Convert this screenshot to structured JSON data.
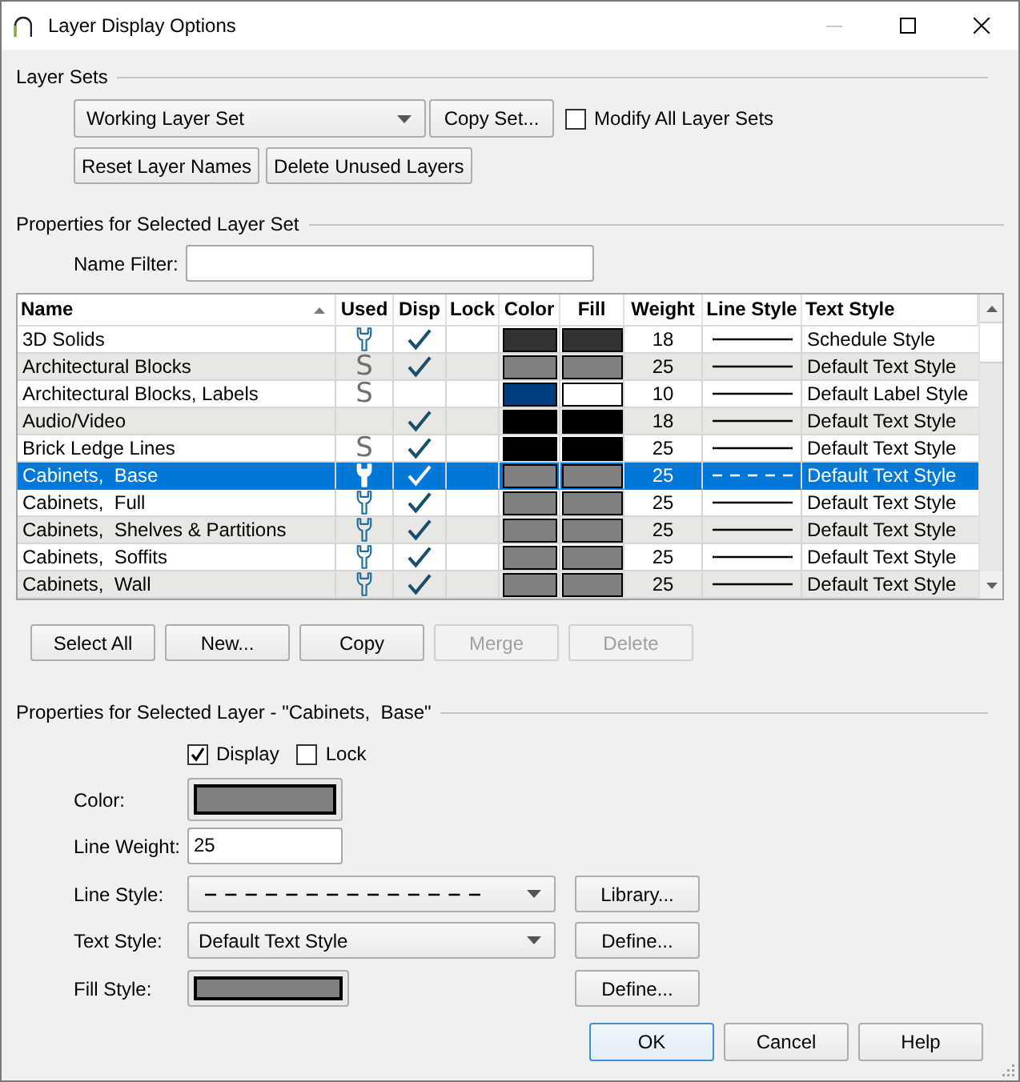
{
  "window": {
    "title": "Layer Display Options",
    "controls": [
      {
        "kind": "minimize",
        "disabled": true
      },
      {
        "kind": "maximize",
        "disabled": false
      },
      {
        "kind": "close",
        "disabled": false
      }
    ]
  },
  "layer_sets": {
    "heading": "Layer Sets",
    "set_dropdown": "Working Layer Set",
    "copy_button": "Copy Set...",
    "modify_all": {
      "label": "Modify All Layer Sets",
      "checked": false
    },
    "buttons": [
      {
        "label": "Reset Layer Names",
        "disabled": false
      },
      {
        "label": "Delete Unused Layers",
        "disabled": false
      }
    ]
  },
  "layer_set_properties": {
    "heading": "Properties for Selected Layer Set",
    "name_filter_label": "Name Filter:"
  },
  "table": {
    "columns": [
      {
        "label": "Name",
        "sorted": true
      },
      {
        "label": "Used",
        "sorted": false
      },
      {
        "label": "Disp",
        "sorted": false
      },
      {
        "label": "Lock",
        "sorted": false
      },
      {
        "label": "Color",
        "sorted": false
      },
      {
        "label": "Fill",
        "sorted": false
      },
      {
        "label": "Weight",
        "sorted": false
      },
      {
        "label": "Line Style",
        "sorted": false
      },
      {
        "label": "Text Style",
        "sorted": false
      }
    ],
    "rows": [
      {
        "name": "3D Solids",
        "used": {
          "kind": "wrench"
        },
        "display": true,
        "lock": false,
        "color": "#333333",
        "fill": {
          "color": "#333333"
        },
        "weight": "18",
        "line": {
          "kind": "solid"
        },
        "text_style": "Schedule Style",
        "selected": false
      },
      {
        "name": "Architectural Blocks",
        "used": {
          "kind": "letter",
          "text": "S"
        },
        "display": true,
        "lock": false,
        "color": "#808080",
        "fill": {
          "color": "#808080"
        },
        "weight": "25",
        "line": {
          "kind": "solid"
        },
        "text_style": "Default Text Style",
        "selected": false
      },
      {
        "name": "Architectural Blocks, Labels",
        "used": {
          "kind": "letter",
          "text": "S"
        },
        "display": false,
        "lock": false,
        "color": "#003f7f",
        "fill": {
          "color": "#ffffff"
        },
        "weight": "10",
        "line": {
          "kind": "solid"
        },
        "text_style": "Default Label Style",
        "selected": false
      },
      {
        "name": "Audio/Video",
        "display": true,
        "lock": false,
        "color": "#000000",
        "fill": {
          "color": "#000000"
        },
        "weight": "18",
        "line": {
          "kind": "solid"
        },
        "text_style": "Default Text Style",
        "selected": false
      },
      {
        "name": "Brick Ledge Lines",
        "used": {
          "kind": "letter",
          "text": "S"
        },
        "display": true,
        "lock": false,
        "color": "#000000",
        "fill": {
          "color": "#000000"
        },
        "weight": "25",
        "line": {
          "kind": "solid"
        },
        "text_style": "Default Text Style",
        "selected": false
      },
      {
        "name": "Cabinets,  Base",
        "used": {
          "kind": "wrench"
        },
        "display": true,
        "lock": false,
        "color": "#808080",
        "fill": {
          "color": "#808080"
        },
        "weight": "25",
        "line": {
          "kind": "dashed"
        },
        "text_style": "Default Text Style",
        "selected": true
      },
      {
        "name": "Cabinets,  Full",
        "used": {
          "kind": "wrench"
        },
        "display": true,
        "lock": false,
        "color": "#808080",
        "fill": {
          "color": "#808080"
        },
        "weight": "25",
        "line": {
          "kind": "solid"
        },
        "text_style": "Default Text Style",
        "selected": false
      },
      {
        "name": "Cabinets,  Shelves & Partitions",
        "used": {
          "kind": "wrench"
        },
        "display": true,
        "lock": false,
        "color": "#808080",
        "fill": {
          "color": "#808080"
        },
        "weight": "25",
        "line": {
          "kind": "solid"
        },
        "text_style": "Default Text Style",
        "selected": false
      },
      {
        "name": "Cabinets,  Soffits",
        "used": {
          "kind": "wrench"
        },
        "display": true,
        "lock": false,
        "color": "#808080",
        "fill": {
          "color": "#808080"
        },
        "weight": "25",
        "line": {
          "kind": "solid"
        },
        "text_style": "Default Text Style",
        "selected": false
      },
      {
        "name": "Cabinets,  Wall",
        "used": {
          "kind": "wrench"
        },
        "display": true,
        "lock": false,
        "color": "#808080",
        "fill": {
          "color": "#808080"
        },
        "weight": "25",
        "line": {
          "kind": "solid"
        },
        "text_style": "Default Text Style",
        "selected": false
      }
    ]
  },
  "table_buttons": [
    {
      "label": "Select All",
      "disabled": false
    },
    {
      "label": "New...",
      "disabled": false
    },
    {
      "label": "Copy",
      "disabled": false
    },
    {
      "label": "Merge",
      "disabled": true
    },
    {
      "label": "Delete",
      "disabled": true
    }
  ],
  "layer_properties": {
    "heading": "Properties for Selected Layer - \"Cabinets,  Base\"",
    "display": {
      "label": "Display",
      "checked": true
    },
    "lock": {
      "label": "Lock",
      "checked": false
    },
    "color": {
      "label": "Color:",
      "color": "#808080"
    },
    "line_weight": {
      "label": "Line Weight:",
      "value": "25"
    },
    "line_style": {
      "label": "Line Style:",
      "line": {
        "kind": "dashed"
      },
      "button": "Library..."
    },
    "text_style": {
      "label": "Text Style:",
      "value": "Default Text Style",
      "button": "Define..."
    },
    "fill_style": {
      "label": "Fill Style:",
      "color": "#808080",
      "button": "Define..."
    }
  },
  "dialog_buttons": [
    {
      "label": "OK",
      "default": true
    },
    {
      "label": "Cancel",
      "default": false
    },
    {
      "label": "Help",
      "default": false
    }
  ]
}
